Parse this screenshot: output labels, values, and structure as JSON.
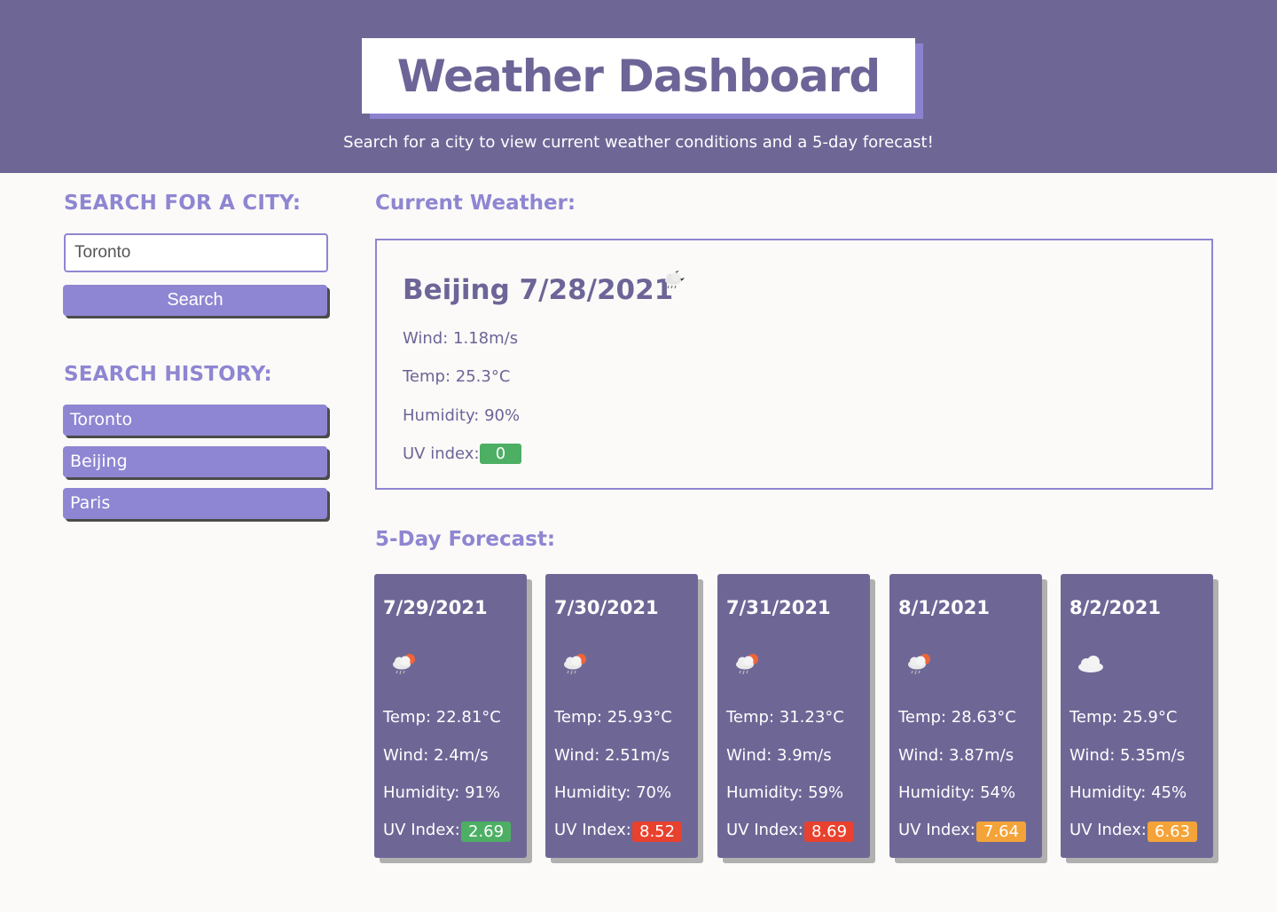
{
  "header": {
    "title": "Weather Dashboard",
    "subtitle": "Search for a city to view current weather conditions and a 5-day forecast!"
  },
  "sidebar": {
    "search_heading": "SEARCH FOR A CITY:",
    "search_value": "Toronto",
    "search_button": "Search",
    "history_heading": "SEARCH HISTORY:",
    "history": [
      "Toronto",
      "Beijing",
      "Paris"
    ]
  },
  "current": {
    "heading": "Current Weather:",
    "title": "Beijing 7/28/2021",
    "icon": "night-rain-icon",
    "wind": "Wind: 1.18m/s",
    "temp": "Temp: 25.3°C",
    "humidity": "Humidity: 90%",
    "uv_label": "UV index:",
    "uv_value": "0",
    "uv_color": "#4caf64"
  },
  "forecast": {
    "heading": "5-Day Forecast:",
    "days": [
      {
        "date": "7/29/2021",
        "icon": "sun-rain-icon",
        "temp": "Temp: 22.81°C",
        "wind": "Wind: 2.4m/s",
        "humidity": "Humidity: 91%",
        "uv_label": "UV Index:",
        "uv": "2.69",
        "uv_color": "#4caf64"
      },
      {
        "date": "7/30/2021",
        "icon": "sun-rain-icon",
        "temp": "Temp: 25.93°C",
        "wind": "Wind: 2.51m/s",
        "humidity": "Humidity: 70%",
        "uv_label": "UV Index:",
        "uv": "8.52",
        "uv_color": "#e8412e"
      },
      {
        "date": "7/31/2021",
        "icon": "sun-rain-icon",
        "temp": "Temp: 31.23°C",
        "wind": "Wind: 3.9m/s",
        "humidity": "Humidity: 59%",
        "uv_label": "UV Index:",
        "uv": "8.69",
        "uv_color": "#e8412e"
      },
      {
        "date": "8/1/2021",
        "icon": "sun-rain-icon",
        "temp": "Temp: 28.63°C",
        "wind": "Wind: 3.87m/s",
        "humidity": "Humidity: 54%",
        "uv_label": "UV Index:",
        "uv": "7.64",
        "uv_color": "#f4a338"
      },
      {
        "date": "8/2/2021",
        "icon": "cloud-icon",
        "temp": "Temp: 25.9°C",
        "wind": "Wind: 5.35m/s",
        "humidity": "Humidity: 45%",
        "uv_label": "UV Index:",
        "uv": "6.63",
        "uv_color": "#f4a338"
      }
    ]
  }
}
